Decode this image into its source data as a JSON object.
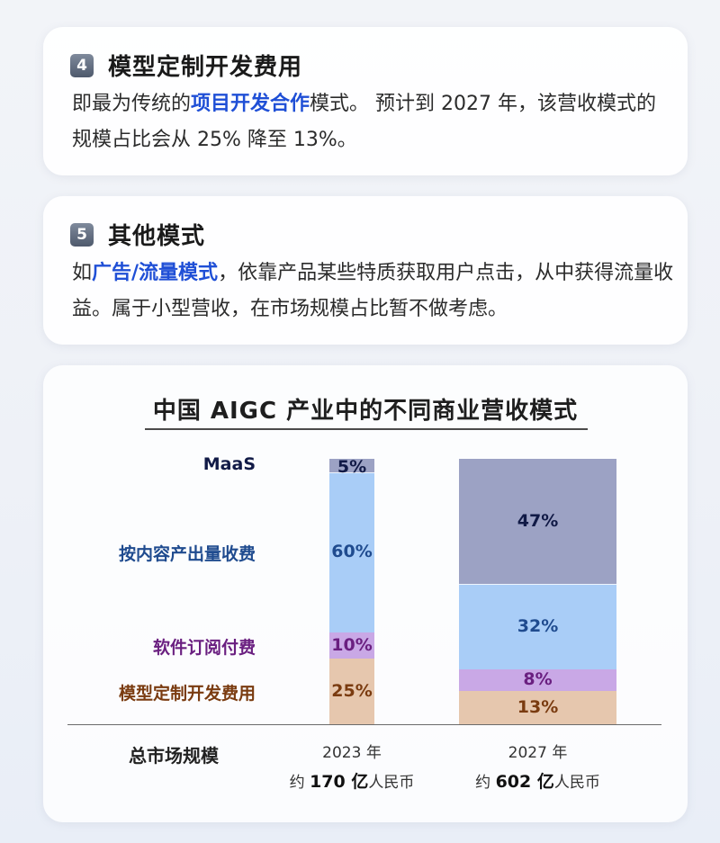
{
  "card4": {
    "number": "4",
    "title": "模型定制开发费用",
    "text_before": "即最为传统的",
    "highlight": "项目开发合作",
    "text_after": "模式。 预计到 2027 年，该营收模式的规模占比会从 25% 降至 13%。"
  },
  "card5": {
    "number": "5",
    "title": "其他模式",
    "text_before": "如",
    "highlight": "广告/流量模式",
    "text_after": "，依靠产品某些特质获取用户点击，从中获得流量收益。属于小型营收，在市场规模占比暂不做考虑。"
  },
  "chart_data": {
    "type": "bar",
    "stacked": true,
    "percent": true,
    "title": "中国 AIGC 产业中的不同商业营收模式",
    "categories": [
      "2023 年",
      "2027 年"
    ],
    "series": [
      {
        "name": "模型定制开发费用",
        "values": [
          25,
          13
        ],
        "color": "#e6c7ae",
        "label_color": "#7a3b10"
      },
      {
        "name": "软件订阅付费",
        "values": [
          10,
          8
        ],
        "color": "#c9a8e6",
        "label_color": "#6a1f80"
      },
      {
        "name": "按内容产出量收费",
        "values": [
          60,
          32
        ],
        "color": "#a9cdf7",
        "label_color": "#1f4b8f"
      },
      {
        "name": "MaaS",
        "values": [
          5,
          47
        ],
        "color": "#9ca2c4",
        "label_color": "#111a46"
      }
    ],
    "footer_label": "总市场规模",
    "totals": [
      {
        "prefix": "约 ",
        "amount": "170 亿",
        "unit": "人民币"
      },
      {
        "prefix": "约 ",
        "amount": "602 亿",
        "unit": "人民币"
      }
    ],
    "ylim": [
      0,
      100
    ]
  }
}
